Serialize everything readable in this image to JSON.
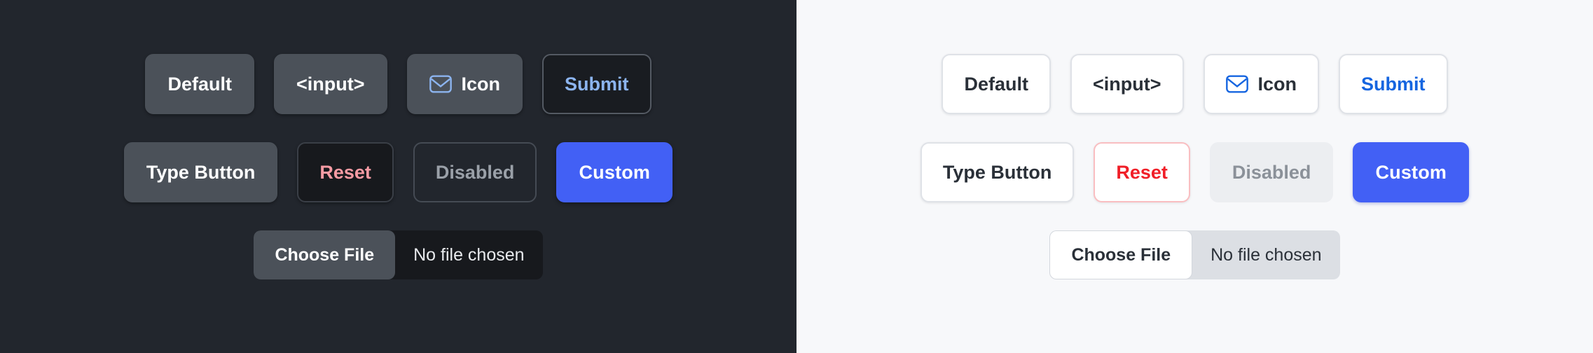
{
  "theme": {
    "dark_background": "#22262d",
    "light_background": "#f7f8fa",
    "accent_blue": "#4260f5",
    "link_blue_dark": "#8cb4ef",
    "link_blue_light": "#1565e0",
    "danger_dark": "#f79ba4",
    "danger_light": "#f01f28",
    "disabled_text_dark": "#9aa0a8",
    "disabled_text_light": "#8b9199"
  },
  "panels": {
    "dark": {
      "name": "dark-theme-panel",
      "row1": [
        {
          "id": "default",
          "label": "Default"
        },
        {
          "id": "input",
          "label": "<input>"
        },
        {
          "id": "icon",
          "label": "Icon",
          "icon": "mail-icon"
        },
        {
          "id": "submit",
          "label": "Submit"
        }
      ],
      "row2": [
        {
          "id": "type-button",
          "label": "Type Button"
        },
        {
          "id": "reset",
          "label": "Reset"
        },
        {
          "id": "disabled",
          "label": "Disabled"
        },
        {
          "id": "custom",
          "label": "Custom"
        }
      ],
      "file_input": {
        "button_label": "Choose File",
        "status_text": "No file chosen"
      }
    },
    "light": {
      "name": "light-theme-panel",
      "row1": [
        {
          "id": "default",
          "label": "Default"
        },
        {
          "id": "input",
          "label": "<input>"
        },
        {
          "id": "icon",
          "label": "Icon",
          "icon": "mail-icon"
        },
        {
          "id": "submit",
          "label": "Submit"
        }
      ],
      "row2": [
        {
          "id": "type-button",
          "label": "Type Button"
        },
        {
          "id": "reset",
          "label": "Reset"
        },
        {
          "id": "disabled",
          "label": "Disabled"
        },
        {
          "id": "custom",
          "label": "Custom"
        }
      ],
      "file_input": {
        "button_label": "Choose File",
        "status_text": "No file chosen"
      }
    }
  }
}
